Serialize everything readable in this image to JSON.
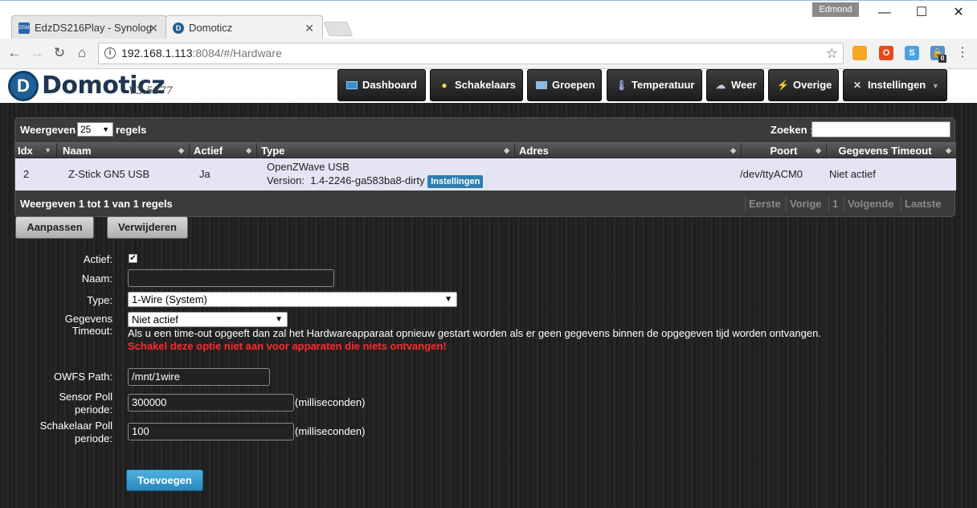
{
  "browser": {
    "tabs": [
      {
        "title": "EdzDS216Play - Synolog",
        "favicon": "dsm-icon"
      },
      {
        "title": "Domoticz",
        "favicon": "domoticz-icon"
      }
    ],
    "profile": "Edmond",
    "url_host": "192.168.1.113",
    "url_path": ":8084/#/Hardware",
    "extension_badge": "0"
  },
  "app": {
    "logo_text": "Domoticz",
    "version": "V3.5877",
    "nav": [
      {
        "label": "Dashboard",
        "icon": "monitor-icon"
      },
      {
        "label": "Schakelaars",
        "icon": "lightbulb-icon"
      },
      {
        "label": "Groepen",
        "icon": "group-icon"
      },
      {
        "label": "Temperatuur",
        "icon": "thermometer-icon"
      },
      {
        "label": "Weer",
        "icon": "weather-icon"
      },
      {
        "label": "Overige",
        "icon": "utility-icon"
      },
      {
        "label": "Instellingen",
        "icon": "tools-icon"
      }
    ]
  },
  "table": {
    "show_prefix": "Weergeven",
    "page_size": "25",
    "show_suffix": "regels",
    "search_label": "Zoeken :",
    "columns": [
      "Idx",
      "Naam",
      "Actief",
      "Type",
      "Adres",
      "Poort",
      "Gegevens Timeout"
    ],
    "rows": [
      {
        "idx": "2",
        "name": "Z-Stick GN5 USB",
        "active": "Ja",
        "type_line1": "OpenZWave USB",
        "type_line2": "Version:  1.4-2246-ga583ba8-dirty",
        "type_badge": "Instellingen",
        "address": "",
        "port": "/dev/ttyACM0",
        "timeout": "Niet actief"
      }
    ],
    "info": "Weergeven 1 tot 1 van 1 regels",
    "pager": [
      "Eerste",
      "Vorige",
      "1",
      "Volgende",
      "Laatste"
    ]
  },
  "actions": {
    "update": "Aanpassen",
    "delete": "Verwijderen"
  },
  "form": {
    "active_label": "Actief:",
    "active_checked": true,
    "name_label": "Naam:",
    "name_value": "",
    "type_label": "Type:",
    "type_value": "1-Wire (System)",
    "timeout_label_1": "Gegevens",
    "timeout_label_2": "Timeout:",
    "timeout_value": "Niet actief",
    "timeout_help": "Als u een time-out opgeeft dan zal het Hardwareapparaat opnieuw gestart worden als er geen gegevens binnen de opgegeven tijd worden ontvangen.",
    "timeout_warning": "Schakel deze optie niet aan voor apparaten die niets ontvangen!",
    "owfs_label": "OWFS Path:",
    "owfs_value": "/mnt/1wire",
    "sensor_label_1": "Sensor Poll",
    "sensor_label_2": "periode:",
    "sensor_value": "300000",
    "switch_label_1": "Schakelaar Poll",
    "switch_label_2": "periode:",
    "switch_value": "100",
    "unit": "(milliseconden)",
    "add_button": "Toevoegen"
  },
  "colors": {
    "brand": "#1f5f94",
    "accent_blue": "#2d7fb0",
    "warning": "#ff2a2a",
    "row_bg": "#e4e4f4"
  }
}
